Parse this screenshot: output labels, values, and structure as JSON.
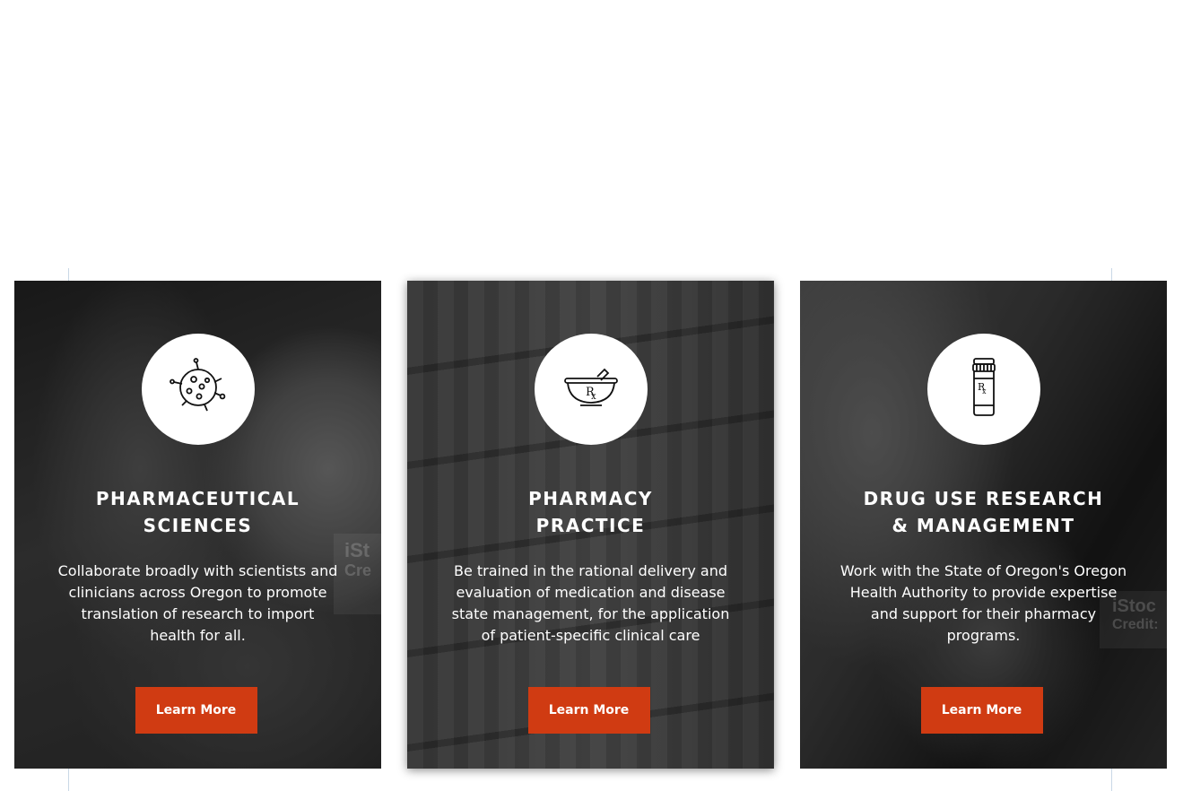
{
  "cards": [
    {
      "icon": "virus-icon",
      "title_lines": [
        "Pharmaceutical",
        "Sciences"
      ],
      "description_lines": [
        "Collaborate broadly with scientists and",
        "clinicians across Oregon to promote",
        "translation of research to import",
        "health for all."
      ],
      "button_label": "Learn More",
      "watermark": [
        "iSt",
        "Cre"
      ]
    },
    {
      "icon": "mortar-pestle-rx-icon",
      "title_lines": [
        "Pharmacy",
        "Practice"
      ],
      "description_lines": [
        "Be trained in the rational delivery and",
        "evaluation of medication and disease",
        "state management, for the application",
        "of patient-specific clinical care"
      ],
      "button_label": "Learn More"
    },
    {
      "icon": "pill-bottle-rx-icon",
      "title_lines": [
        "Drug Use Research",
        "& Management"
      ],
      "description_lines": [
        "Work with the State of Oregon's Oregon",
        "Health Authority to provide expertise",
        "and support for their pharmacy",
        "programs."
      ],
      "button_label": "Learn More",
      "watermark": [
        "iStoc",
        "Credit:"
      ]
    }
  ],
  "colors": {
    "button": "#d03b12",
    "text": "#ffffff",
    "overlay": "#2b2b2b"
  }
}
